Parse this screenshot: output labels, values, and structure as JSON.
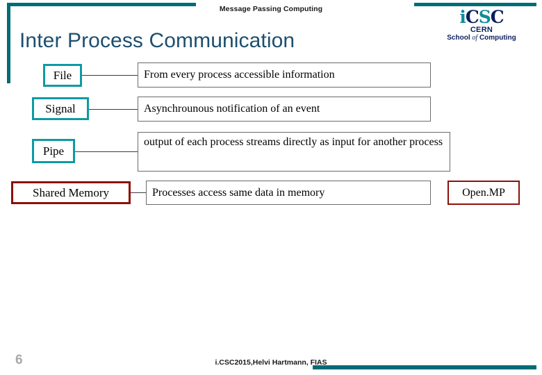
{
  "header": {
    "title": "Message Passing Computing"
  },
  "logo": {
    "main_i": "i",
    "main_c": "C",
    "main_s": "S",
    "main_c2": "C",
    "sub": "CERN",
    "sub2_a": "School",
    "sub2_b": "of",
    "sub2_c": "Computing"
  },
  "slide": {
    "title": "Inter Process Communication"
  },
  "items": [
    {
      "label": "File",
      "description": "From every process accessible information"
    },
    {
      "label": "Signal",
      "description": "Asynchrounous notification of an event"
    },
    {
      "label": "Pipe",
      "description": "output of each process streams directly as input for another process"
    },
    {
      "label": "Shared Memory",
      "description": "Processes access same data in memory"
    }
  ],
  "aside": {
    "label": "Open.MP"
  },
  "footer": {
    "page_number": "6",
    "text": "i.CSC2015,Helvi Hartmann, FIAS"
  },
  "colors": {
    "teal": "#006c76",
    "box_teal": "#0f9aa3",
    "dark_red": "#8b1008",
    "title_blue": "#1d4f6e",
    "logo_navy": "#0b1f5c"
  }
}
